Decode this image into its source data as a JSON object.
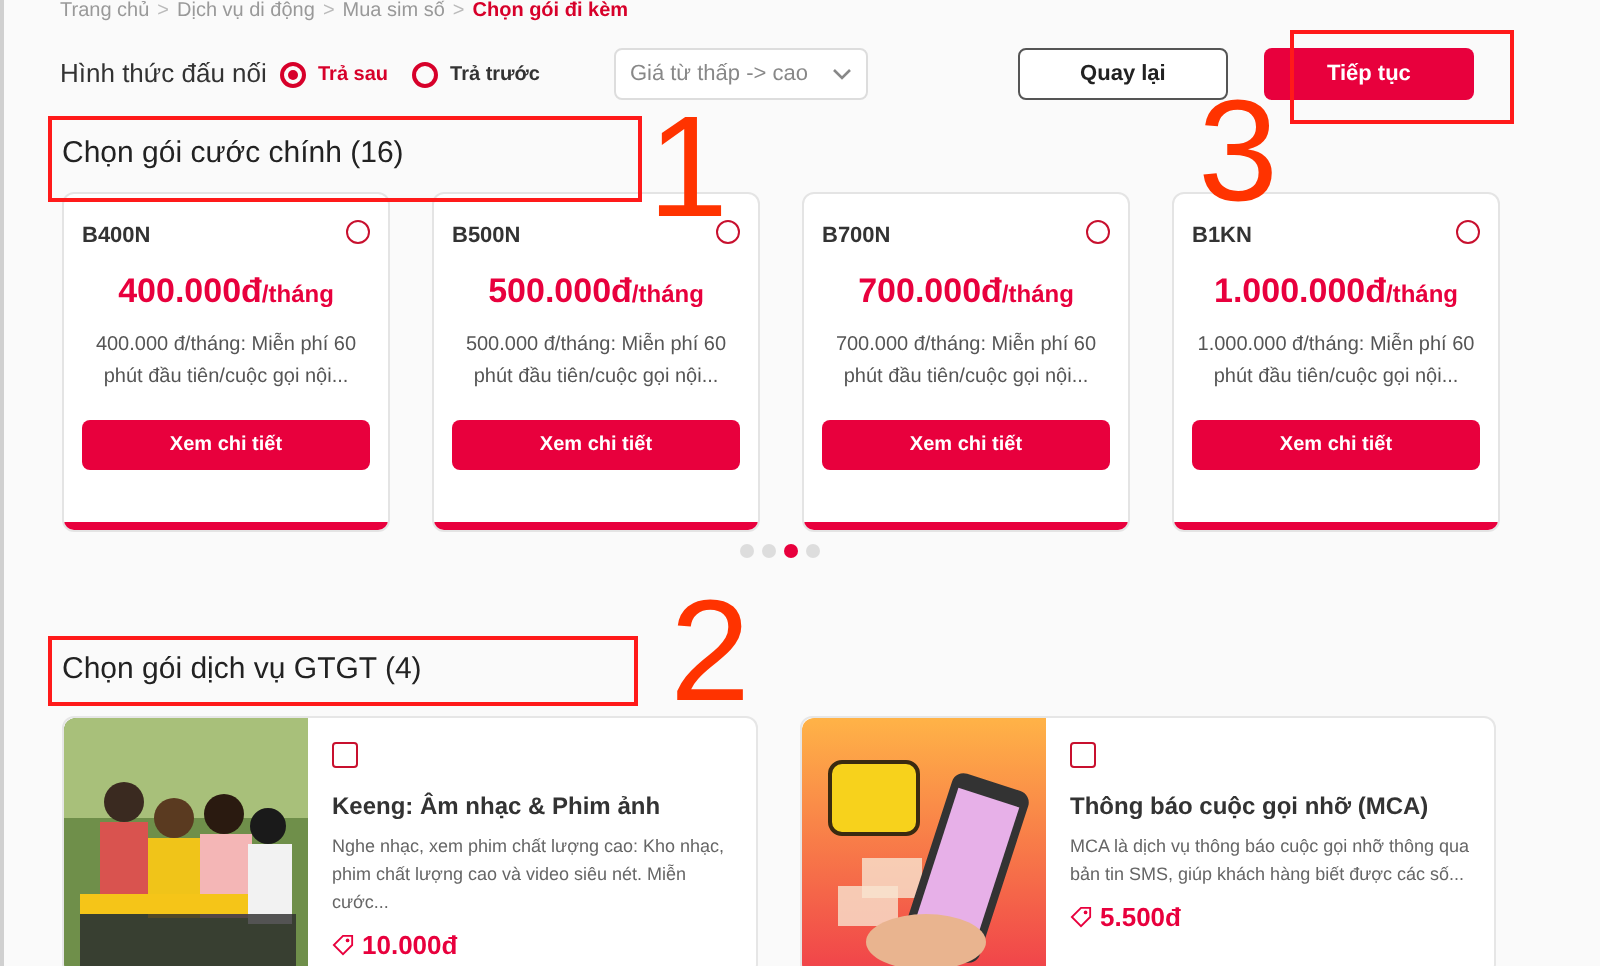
{
  "breadcrumb": {
    "separator": ">",
    "items": [
      "Trang chủ",
      "Dịch vụ di động",
      "Mua sim số",
      "Chọn gói đi kèm"
    ]
  },
  "connection": {
    "label": "Hình thức đấu nối",
    "options": [
      {
        "label": "Trả sau",
        "selected": true
      },
      {
        "label": "Trả trước",
        "selected": false
      }
    ]
  },
  "sort": {
    "value": "Giá từ thấp -> cao"
  },
  "buttons": [
    {
      "label": "Quay lại",
      "kind": "outline"
    },
    {
      "label": "Tiếp tục",
      "kind": "primary"
    }
  ],
  "main_section": {
    "title": "Chọn gói cước chính (16)",
    "plans": [
      {
        "name": "B400N",
        "price": "400.000đ",
        "unit": "/tháng",
        "description": "400.000 đ/tháng: Miễn phí 60 phút đầu tiên/cuộc gọi nội...",
        "button": "Xem chi tiết",
        "selected": false
      },
      {
        "name": "B500N",
        "price": "500.000đ",
        "unit": "/tháng",
        "description": "500.000 đ/tháng: Miễn phí 60 phút đầu tiên/cuộc gọi nội...",
        "button": "Xem chi tiết",
        "selected": false
      },
      {
        "name": "B700N",
        "price": "700.000đ",
        "unit": "/tháng",
        "description": "700.000 đ/tháng: Miễn phí 60 phút đầu tiên/cuộc gọi nội...",
        "button": "Xem chi tiết",
        "selected": false
      },
      {
        "name": "B1KN",
        "price": "1.000.000đ",
        "unit": "/tháng",
        "description": "1.000.000 đ/tháng: Miễn phí 60 phút đầu tiên/cuộc gọi nội...",
        "button": "Xem chi tiết",
        "selected": false
      }
    ],
    "pages": [
      {
        "selected": false
      },
      {
        "selected": false
      },
      {
        "selected": true
      },
      {
        "selected": false
      }
    ]
  },
  "service_section": {
    "title": "Chọn gói dịch vụ GTGT (4)",
    "services": [
      {
        "name": "Keeng: Âm nhạc & Phim ảnh",
        "description": "Nghe nhạc, xem phim chất lượng cao: Kho nhạc, phim chất lượng cao và video siêu nét. Miễn cước...",
        "price": "10.000đ",
        "checked": false
      },
      {
        "name": "Thông báo cuộc gọi nhỡ (MCA)",
        "description": "MCA là dịch vụ thông báo cuộc gọi nhỡ thông qua bản tin SMS, giúp khách hàng biết được các số...",
        "price": "5.500đ",
        "checked": false
      }
    ]
  },
  "annotations": [
    "1",
    "2",
    "3"
  ]
}
